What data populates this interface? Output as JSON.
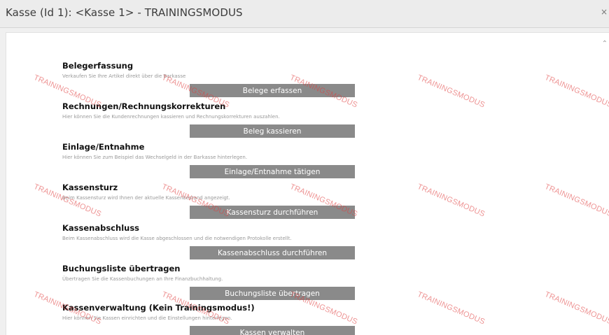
{
  "window": {
    "title": "Kasse (Id 1): <Kasse 1> - TRAININGSMODUS",
    "close_glyph": "×"
  },
  "panel": {
    "scroll_glyph": "⌃"
  },
  "sections": [
    {
      "heading": "Belegerfassung",
      "description": "Verkaufen Sie Ihre Artikel direkt über die Barkasse",
      "button": "Belege erfassen"
    },
    {
      "heading": "Rechnungen/Rechnungskorrekturen",
      "description": "Hier können Sie die Kundenrechnungen kassieren und Rechnungskorrekturen auszahlen.",
      "button": "Beleg kassieren"
    },
    {
      "heading": "Einlage/Entnahme",
      "description": "Hier können Sie zum Beispiel das Wechselgeld in der Barkasse hinterlegen.",
      "button": "Einlage/Entnahme tätigen"
    },
    {
      "heading": "Kassensturz",
      "description": "Beim Kassensturz wird Ihnen der aktuelle Kassenbestand angezeigt.",
      "button": "Kassensturz durchführen"
    },
    {
      "heading": "Kassenabschluss",
      "description": "Beim Kassenabschluss wird die Kasse abgeschlossen und die notwendigen Protokolle erstellt.",
      "button": "Kassenabschluss durchführen"
    },
    {
      "heading": "Buchungsliste übertragen",
      "description": "Übertragen Sie die Kassenbuchungen an Ihre Finanzbuchhaltung.",
      "button": "Buchungsliste übertragen"
    },
    {
      "heading": "Kassenverwaltung (Kein Trainingsmodus!)",
      "description": "Hier können Sie Kassen einrichten und die Einstellungen hinterlegen.",
      "button": "Kassen verwalten"
    }
  ],
  "watermark": {
    "text": "TRAININGSMODUS",
    "color": "#e03c3c"
  },
  "colors": {
    "button_bg": "#8a8a8a",
    "button_text": "#ffffff"
  }
}
